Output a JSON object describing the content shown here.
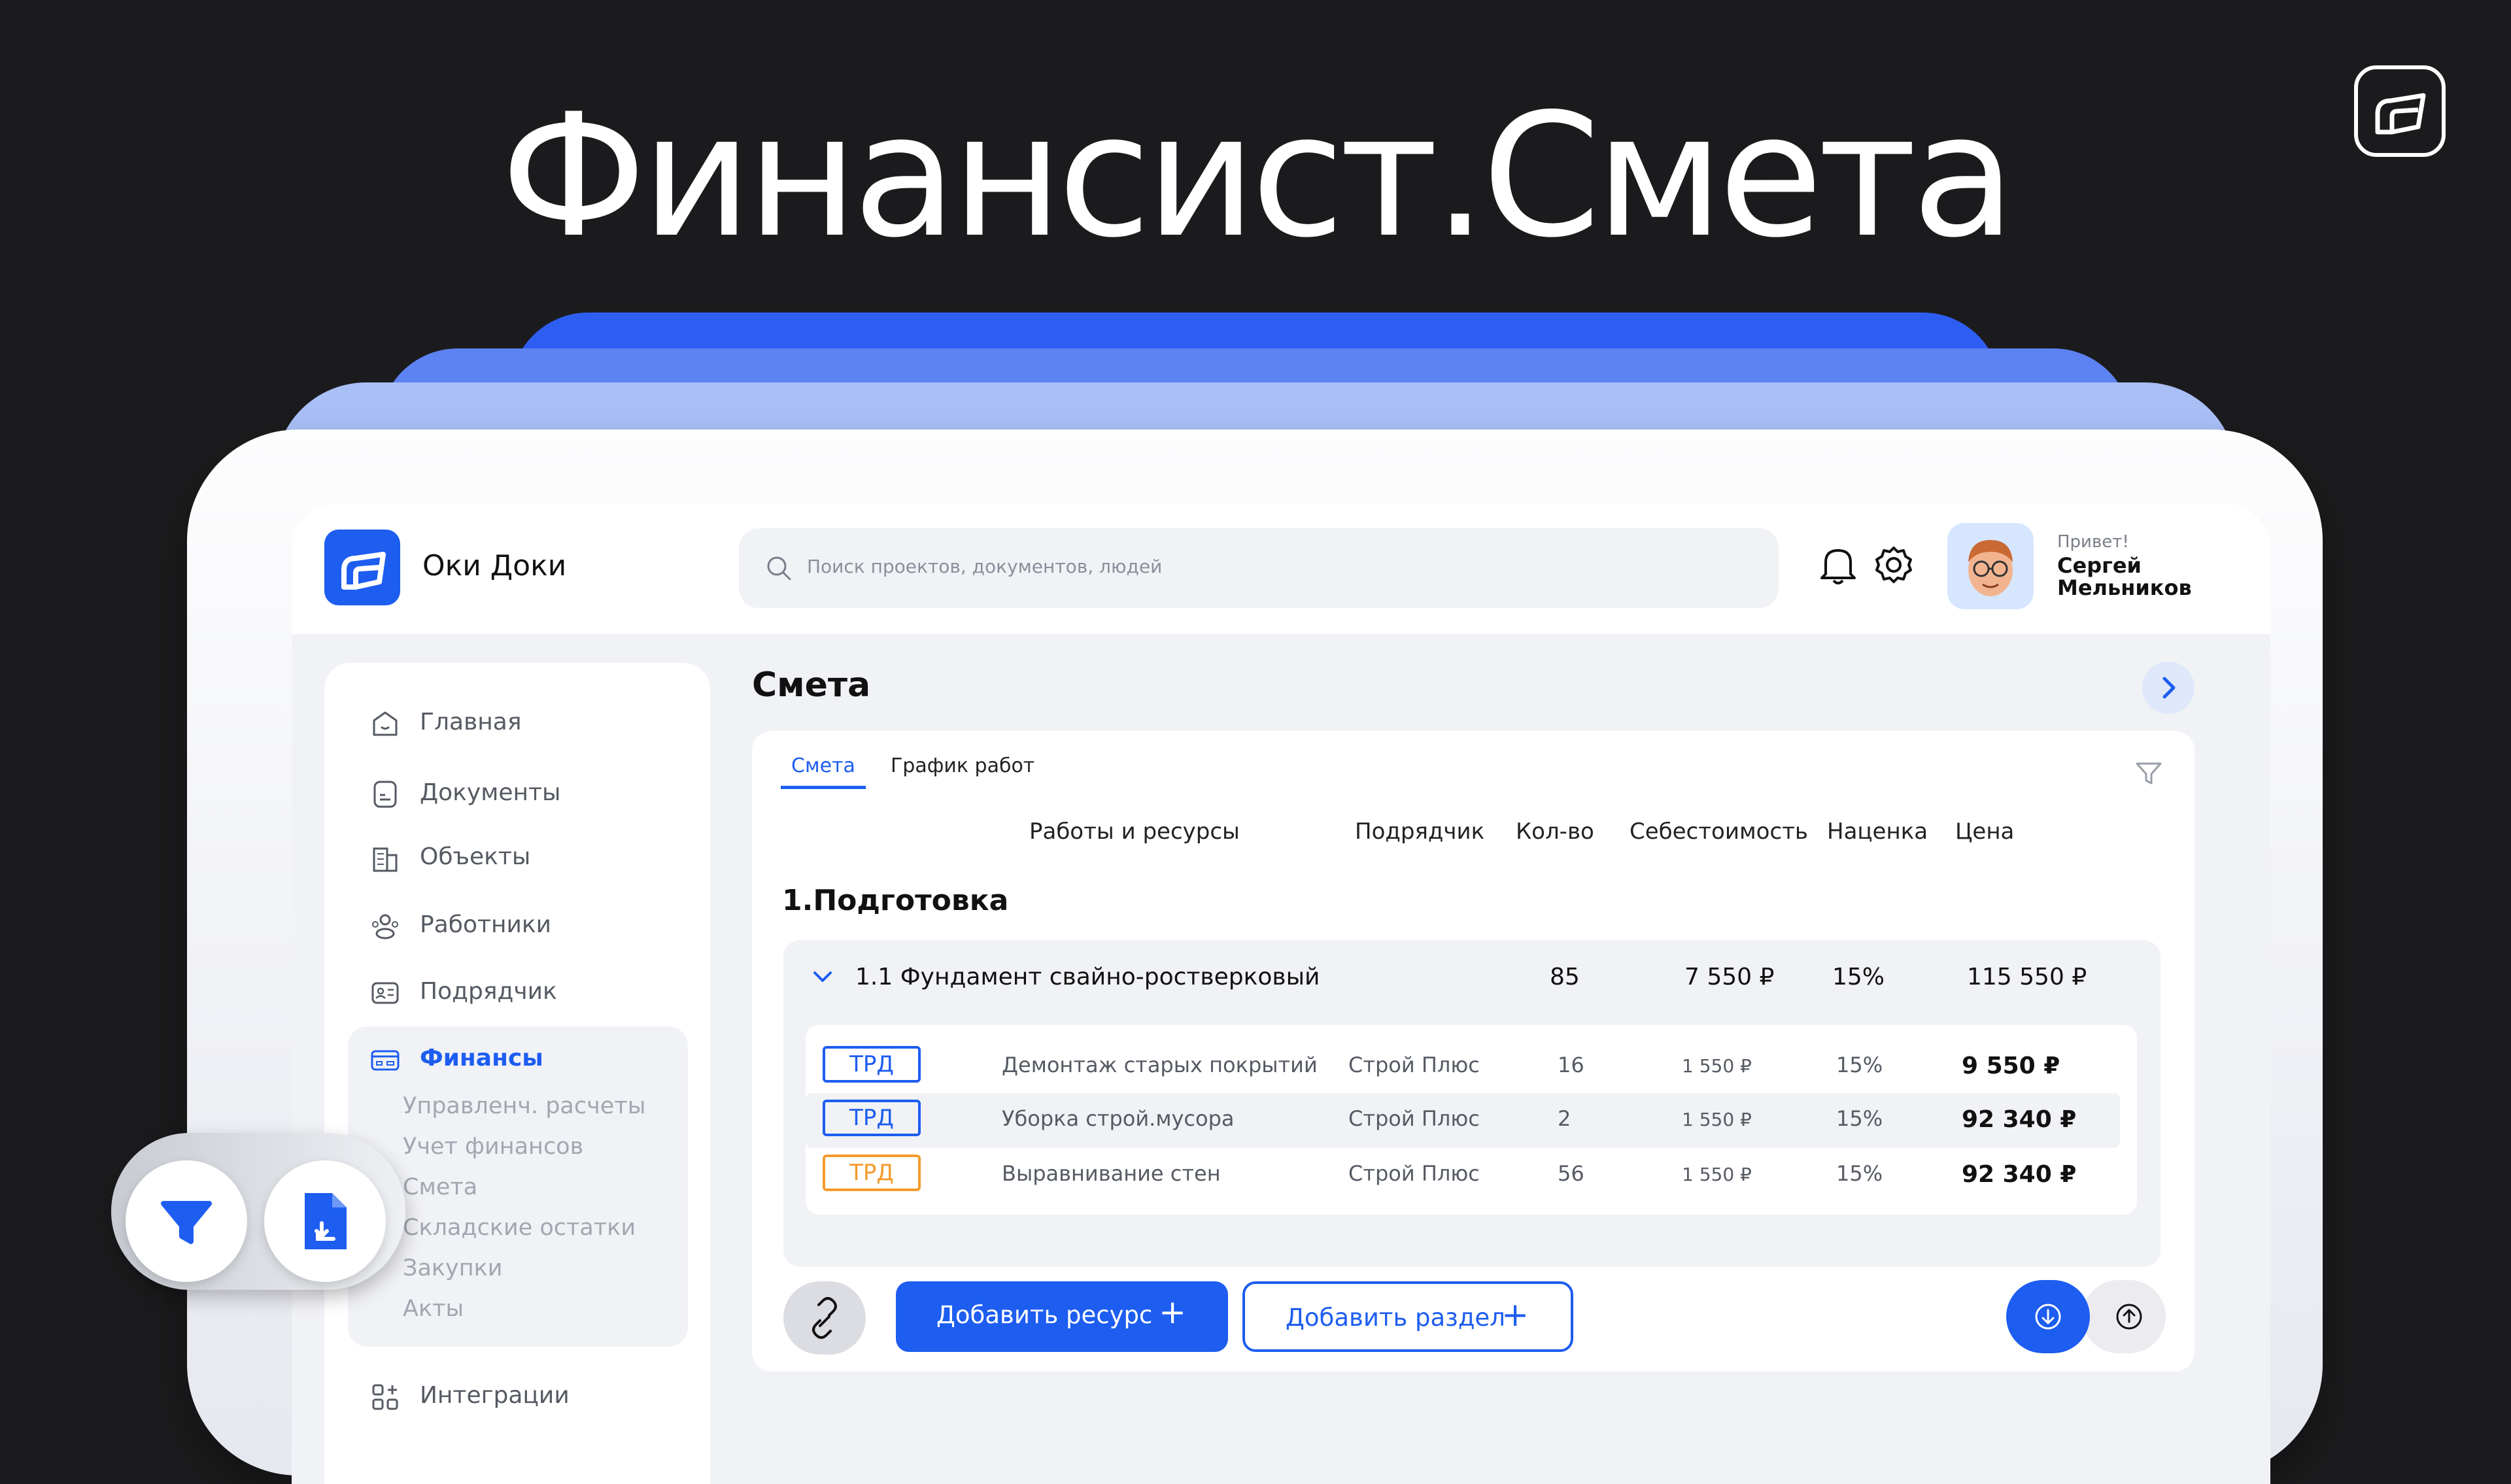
{
  "headline": "Финансист.Смета",
  "app": {
    "brand": "Оки Доки",
    "search_placeholder": "Поиск проектов, документов, людей",
    "user": {
      "greeting": "Привет!",
      "name": "Сергей Мельников"
    }
  },
  "sidebar": {
    "items": [
      {
        "label": "Главная",
        "icon": "home-icon"
      },
      {
        "label": "Документы",
        "icon": "document-icon"
      },
      {
        "label": "Объекты",
        "icon": "building-icon"
      },
      {
        "label": "Работники",
        "icon": "people-icon"
      },
      {
        "label": "Подрядчик",
        "icon": "id-card-icon"
      },
      {
        "label": "Финансы",
        "icon": "card-icon"
      },
      {
        "label": "Интеграции",
        "icon": "apps-icon"
      }
    ],
    "finance_sub": [
      "Управленч. расчеты",
      "Учет финансов",
      "Смета",
      "Складские остатки",
      "Закупки",
      "Акты"
    ]
  },
  "page": {
    "title": "Смета",
    "tabs": [
      "Смета",
      "График работ"
    ],
    "columns": [
      "Работы и ресурсы",
      "Подрядчик",
      "Кол-во",
      "Себестоимость",
      "Наценка",
      "Цена"
    ],
    "section": "1.Подготовка",
    "group": {
      "name": "1.1 Фундамент свайно-ростверковый",
      "qty": "85",
      "cost": "7 550 ₽",
      "markup": "15%",
      "price": "115 550 ₽"
    },
    "rows": [
      {
        "badge": "ТРД",
        "badge_color": "#1d5df0",
        "name": "Демонтаж старых покрытий",
        "contractor": "Строй Плюс",
        "qty": "16",
        "cost": "1 550 ₽",
        "markup": "15%",
        "price": "9 550 ₽"
      },
      {
        "badge": "ТРД",
        "badge_color": "#1d5df0",
        "name": "Уборка строй.мусора",
        "contractor": "Строй Плюс",
        "qty": "2",
        "cost": "1 550 ₽",
        "markup": "15%",
        "price": "92 340 ₽"
      },
      {
        "badge": "ТРД",
        "badge_color": "#f39a2c",
        "name": "Выравнивание стен",
        "contractor": "Строй Плюс",
        "qty": "56",
        "cost": "1 550 ₽",
        "markup": "15%",
        "price": "92 340 ₽"
      }
    ],
    "buttons": {
      "add_resource": "Добавить ресурс",
      "add_section": "Добавить раздел"
    }
  },
  "colors": {
    "accent": "#1d5df0",
    "orange": "#f39a2c",
    "background": "#1b1b1d"
  }
}
